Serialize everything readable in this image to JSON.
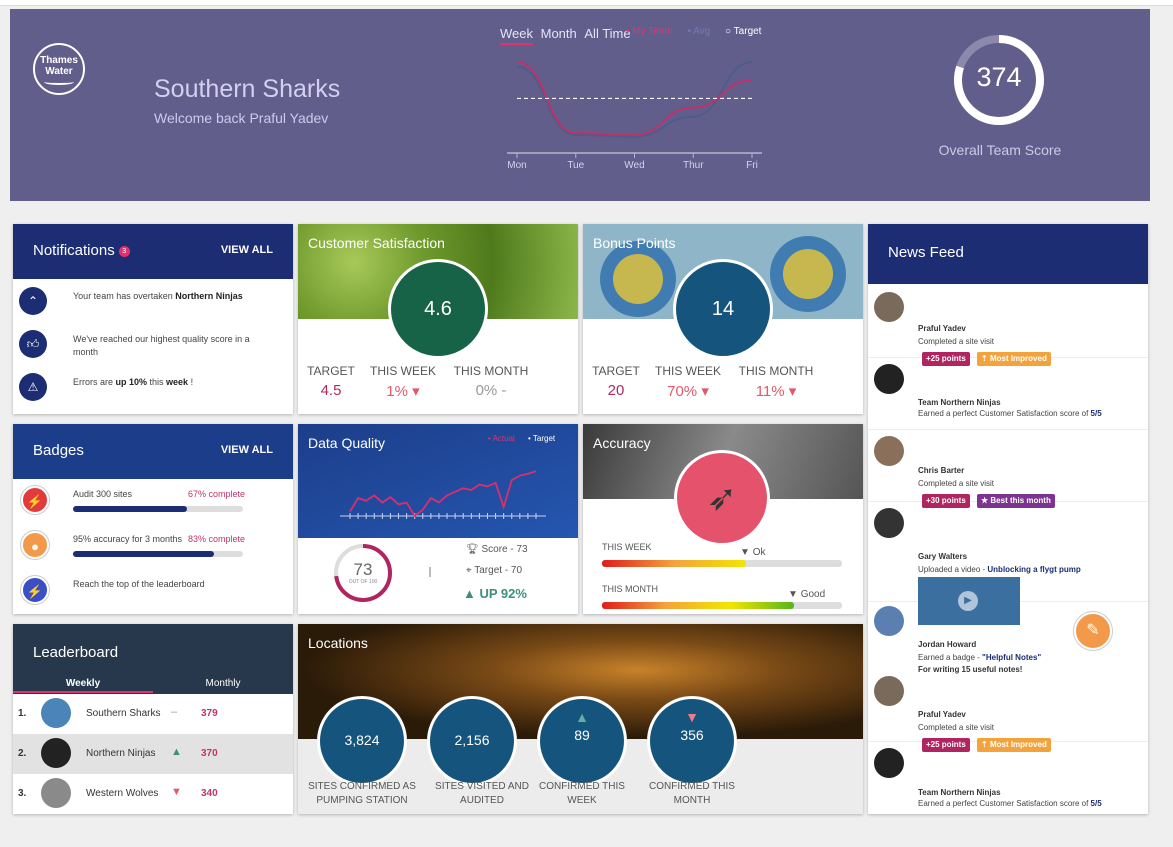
{
  "header": {
    "logo_text": "Thames Water",
    "team_name": "Southern Sharks",
    "welcome": "Welcome back Praful Yadev",
    "tabs": [
      "Week",
      "Month",
      "All Time"
    ],
    "legend": {
      "team": "My Team",
      "avg": "Avg",
      "target": "Target"
    },
    "chart_data": {
      "type": "line",
      "categories": [
        "Mon",
        "Tue",
        "Wed",
        "Thur",
        "Fri"
      ],
      "series": [
        {
          "values": [
            95,
            20,
            18,
            40,
            100
          ]
        },
        {
          "values": [
            100,
            22,
            20,
            50,
            80
          ]
        }
      ],
      "target": 60,
      "ylim": [
        0,
        110
      ]
    },
    "overall_score": "374",
    "overall_score_fraction": 0.8,
    "overall_label": "Overall Team Score",
    "colors": {
      "bg": "#625e8c",
      "team_line": "#c2306a",
      "avg_line": "#4d5c8a"
    }
  },
  "notifications": {
    "title": "Notifications",
    "count": "3",
    "view_all": "VIEW ALL",
    "items": [
      {
        "icon": "chevron-up-icon",
        "pre": "Your team has overtaken ",
        "bold": "Northern Ninjas",
        "post": ""
      },
      {
        "icon": "thumbs-up-icon",
        "pre": "We've reached our highest quality score in a month",
        "bold": "",
        "post": ""
      },
      {
        "icon": "warning-icon",
        "pre": "Errors are ",
        "bold": "up  10%",
        "mid": " this ",
        "bold2": "week",
        "post": " !"
      }
    ]
  },
  "customer_satisfaction": {
    "title": "Customer Satisfaction",
    "value": "4.6",
    "target_label": "TARGET",
    "target": "4.5",
    "week_label": "THIS WEEK",
    "week": "1%",
    "month_label": "THIS MONTH",
    "month": "0%",
    "color": "#176348"
  },
  "bonus_points": {
    "title": "Bonus Points",
    "value": "14",
    "target_label": "TARGET",
    "target": "20",
    "week_label": "THIS WEEK",
    "week": "70%",
    "month_label": "THIS MONTH",
    "month": "11%",
    "color": "#15557d"
  },
  "news_feed": {
    "title": "News Feed",
    "items": [
      {
        "name": "Praful Yadev",
        "desc": "Completed a site visit",
        "pills": [
          {
            "text": "+25 points",
            "color": "#b0245f"
          },
          {
            "text": "Most Improved",
            "color": "#f3a33c"
          }
        ]
      },
      {
        "name": "Team Northern Ninjas",
        "desc_pre": "Earned a perfect Customer Satisfaction score of ",
        "desc_bold": "5/5"
      },
      {
        "name": "Chris Barter",
        "desc": "Completed a site visit",
        "pills": [
          {
            "text": "+30 points",
            "color": "#b0245f"
          },
          {
            "text": "Best this month",
            "color": "#7c3392"
          }
        ]
      },
      {
        "name": "Gary Walters",
        "desc_pre": "Uploaded a video - ",
        "desc_bold": "Unblocking a flygt pump"
      },
      {
        "name": "Jordan Howard",
        "desc_pre": "Earned a badge - ",
        "desc_bold": "\"Helpful Notes\"",
        "extra": "For writing 15 useful notes!"
      },
      {
        "name": "Praful Yadev",
        "desc": "Completed a site visit",
        "pills": [
          {
            "text": "+25 points",
            "color": "#b0245f"
          },
          {
            "text": "Most Improved",
            "color": "#f3a33c"
          }
        ]
      },
      {
        "name": "Team Northern Ninjas",
        "desc_pre": "Earned a perfect Customer Satisfaction score of ",
        "desc_bold": "5/5"
      }
    ]
  },
  "badges": {
    "title": "Badges",
    "view_all": "VIEW ALL",
    "items": [
      {
        "name": "Audit 300 sites",
        "pct": "67% complete",
        "fraction": 0.67,
        "color": "#e23b3b"
      },
      {
        "name": "95% accuracy for 3 months",
        "pct": "83% complete",
        "fraction": 0.83,
        "color": "#f39a4a"
      },
      {
        "name": "Reach the top of the leaderboard",
        "pct": "",
        "fraction": 0,
        "color": "#3a4fc6"
      }
    ]
  },
  "data_quality": {
    "title": "Data Quality",
    "legend_actual": "Actual",
    "legend_target": "Target",
    "chart_data": {
      "type": "line",
      "values": [
        40,
        55,
        52,
        58,
        50,
        56,
        48,
        50,
        35,
        42,
        55,
        50,
        58,
        62,
        66,
        64,
        70,
        68,
        72,
        45,
        75,
        80,
        82,
        85
      ]
    },
    "score_value": "73",
    "score_fraction": 0.73,
    "score_sub": "OUT OF 100",
    "score_text": "Score - 73",
    "target_text": "Target - 70",
    "up_text": "UP 92%"
  },
  "accuracy": {
    "title": "Accuracy",
    "week_label": "THIS WEEK",
    "week_status": "Ok",
    "week_fraction": 0.6,
    "month_label": "THIS MONTH",
    "month_status": "Good",
    "month_fraction": 0.8
  },
  "leaderboard": {
    "title": "Leaderboard",
    "tabs": [
      "Weekly",
      "Monthly"
    ],
    "rows": [
      {
        "rank": "1.",
        "name": "Southern Sharks",
        "trend": "–",
        "points": "379"
      },
      {
        "rank": "2.",
        "name": "Northern Ninjas",
        "trend": "▲",
        "points": "370"
      },
      {
        "rank": "3.",
        "name": "Western Wolves",
        "trend": "▼",
        "points": "340"
      }
    ]
  },
  "locations": {
    "title": "Locations",
    "stats": [
      {
        "value": "3,824",
        "label": "SITES CONFIRMED AS PUMPING STATION"
      },
      {
        "value": "2,156",
        "label": "SITES VISITED AND AUDITED"
      },
      {
        "value": "89",
        "label": "CONFIRMED THIS WEEK",
        "arrow": "▲"
      },
      {
        "value": "356",
        "label": "CONFIRMED THIS MONTH",
        "arrow": "▼"
      }
    ]
  }
}
